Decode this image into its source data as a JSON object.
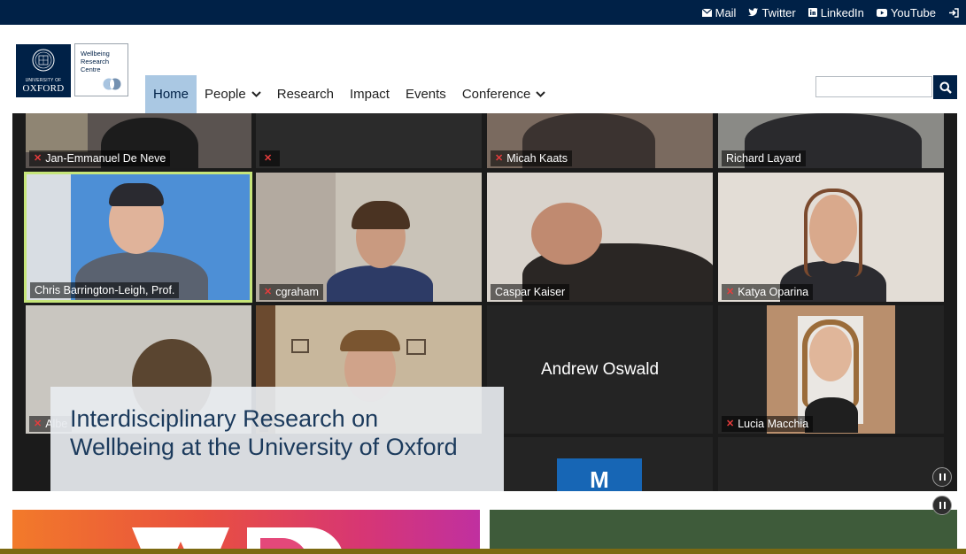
{
  "topbar": {
    "links": [
      {
        "label": "Mail",
        "icon": "mail-icon"
      },
      {
        "label": "Twitter",
        "icon": "twitter-icon"
      },
      {
        "label": "LinkedIn",
        "icon": "linkedin-icon"
      },
      {
        "label": "YouTube",
        "icon": "youtube-icon"
      }
    ],
    "login_icon": "login-icon"
  },
  "logo": {
    "university_small": "UNIVERSITY OF",
    "university_big": "OXFORD",
    "centre_line1": "Wellbeing",
    "centre_line2": "Research",
    "centre_line3": "Centre"
  },
  "nav": {
    "items": [
      {
        "label": "Home",
        "active": true
      },
      {
        "label": "People",
        "dropdown": true
      },
      {
        "label": "Research"
      },
      {
        "label": "Impact"
      },
      {
        "label": "Events"
      },
      {
        "label": "Conference",
        "dropdown": true
      }
    ]
  },
  "search": {
    "placeholder": "",
    "button_icon": "search-icon"
  },
  "hero": {
    "participants": [
      "Jan-Emmanuel De Neve",
      "",
      "Micah Kaats",
      "Richard Layard",
      "Chris Barrington-Leigh, Prof.",
      "cgraham",
      "Caspar Kaiser",
      "Katya Oparina",
      "Albe",
      "",
      "Andrew Oswald",
      "Lucia Macchia"
    ],
    "caption_line1": "Interdisciplinary Research on",
    "caption_line2": "Wellbeing at the University of Oxford",
    "tile_letter": "M"
  },
  "colors": {
    "oxford_blue": "#002147",
    "nav_active": "#aac8e3",
    "card_green": "#3e5b3a"
  }
}
